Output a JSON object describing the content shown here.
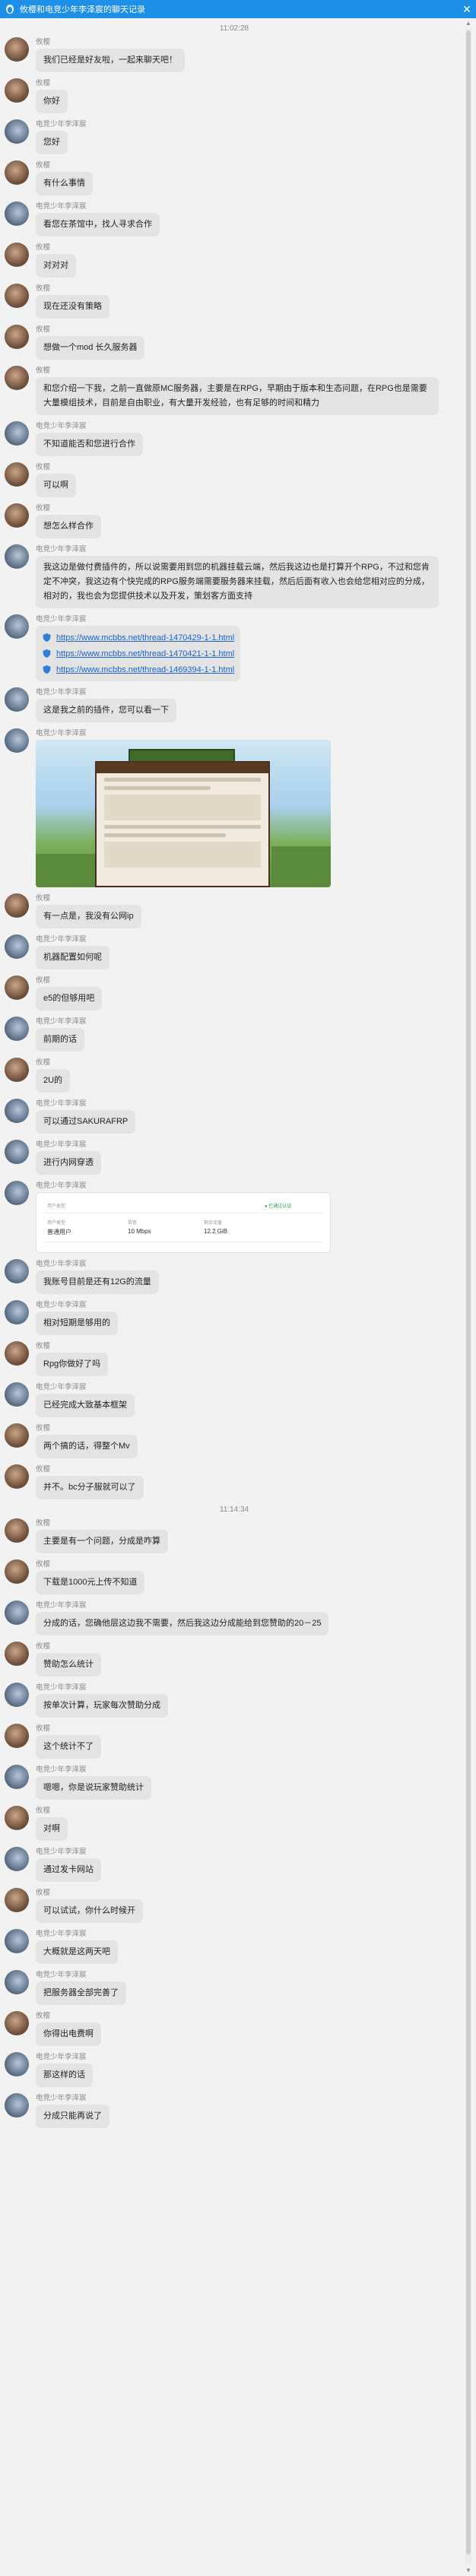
{
  "window": {
    "title": "攸樱和电竞少年李泽宸的聊天记录",
    "close_glyph": "✕"
  },
  "scrollbar": {
    "up": "▲",
    "down": "▼"
  },
  "timestamps": [
    "11:02:28",
    "11:14:34"
  ],
  "users": {
    "a": "攸樱",
    "b": "电竞少年李泽宸"
  },
  "messages_part1": [
    {
      "from": "a",
      "text": "我们已经是好友啦，一起来聊天吧！"
    },
    {
      "from": "a",
      "text": "你好"
    },
    {
      "from": "b",
      "text": "您好"
    },
    {
      "from": "a",
      "text": "有什么事情"
    },
    {
      "from": "b",
      "text": "看您在茶馆中，找人寻求合作"
    },
    {
      "from": "a",
      "text": "对对对"
    },
    {
      "from": "a",
      "text": "现在还没有策略"
    },
    {
      "from": "a",
      "text": "想做一个mod 长久服务器"
    },
    {
      "from": "a",
      "text": "和您介绍一下我，之前一直做原MC服务器，主要是在RPG，早期由于版本和生态问题，在RPG也是需要大量模组技术，目前是自由职业，有大量开发经验，也有足够的时间和精力"
    },
    {
      "from": "b",
      "text": "不知道能否和您进行合作"
    },
    {
      "from": "a",
      "text": "可以啊"
    },
    {
      "from": "a",
      "text": "想怎么样合作"
    },
    {
      "from": "b",
      "text": "我这边是做付费插件的，所以说需要用到您的机器挂载云端，然后我这边也是打算开个RPG，不过和您肯定不冲突，我这边有个快完成的RPG服务端需要服务器来挂载，然后后面有收入也会给您相对应的分成，相对的，我也会为您提供技术以及开发，策划客方面支持"
    }
  ],
  "links": [
    "https://www.mcbbs.net/thread-1470429-1-1.html",
    "https://www.mcbbs.net/thread-1470421-1-1.html",
    "https://www.mcbbs.net/thread-1469394-1-1.html"
  ],
  "messages_part2": [
    {
      "from": "b",
      "text": "这是我之前的插件，您可以看一下"
    }
  ],
  "messages_part3": [
    {
      "from": "a",
      "text": "有一点是，我没有公网ip"
    },
    {
      "from": "b",
      "text": "机器配置如何呢"
    },
    {
      "from": "a",
      "text": "e5的但够用吧"
    },
    {
      "from": "b",
      "text": "前期的话"
    },
    {
      "from": "a",
      "text": "2U的"
    },
    {
      "from": "b",
      "text": "可以通过SAKURAFRP"
    },
    {
      "from": "b",
      "text": "进行内网穿透"
    }
  ],
  "panel": {
    "plan_caption": "用户类型",
    "plan_value": "普通用户",
    "bandwidth_caption": "带宽",
    "bandwidth_value": "10 Mbps",
    "traffic_caption": "剩余流量",
    "traffic_value": "12.2 GiB",
    "status": "● 已通过认证"
  },
  "messages_part4": [
    {
      "from": "b",
      "text": "我账号目前是还有12G的流量"
    },
    {
      "from": "b",
      "text": "相对短期是够用的"
    },
    {
      "from": "a",
      "text": "Rpg你做好了吗"
    },
    {
      "from": "b",
      "text": "已经完成大致基本框架"
    },
    {
      "from": "a",
      "text": "两个搞的话，得整个Mv"
    },
    {
      "from": "a",
      "text": "并不。bc分子服就可以了"
    }
  ],
  "messages_part5": [
    {
      "from": "a",
      "text": "主要是有一个问题，分成是咋算"
    },
    {
      "from": "a",
      "text": "下载是1000元上传不知道"
    },
    {
      "from": "b",
      "text": "分成的话，您确他层这边我不需要，然后我这边分成能给到您赞助的20－25"
    },
    {
      "from": "a",
      "text": "赞助怎么统计"
    },
    {
      "from": "b",
      "text": "按单次计算，玩家每次赞助分成"
    },
    {
      "from": "a",
      "text": "这个统计不了"
    },
    {
      "from": "b",
      "text": "嗯嗯，你是说玩家赞助统计"
    },
    {
      "from": "a",
      "text": "对啊"
    },
    {
      "from": "b",
      "text": "通过发卡网站"
    },
    {
      "from": "a",
      "text": "可以试试，你什么时候开"
    },
    {
      "from": "b",
      "text": "大概就是这两天吧"
    },
    {
      "from": "b",
      "text": "把服务器全部完善了"
    },
    {
      "from": "a",
      "text": "你得出电费啊"
    },
    {
      "from": "b",
      "text": "那这样的话"
    },
    {
      "from": "b",
      "text": "分成只能再说了"
    }
  ]
}
